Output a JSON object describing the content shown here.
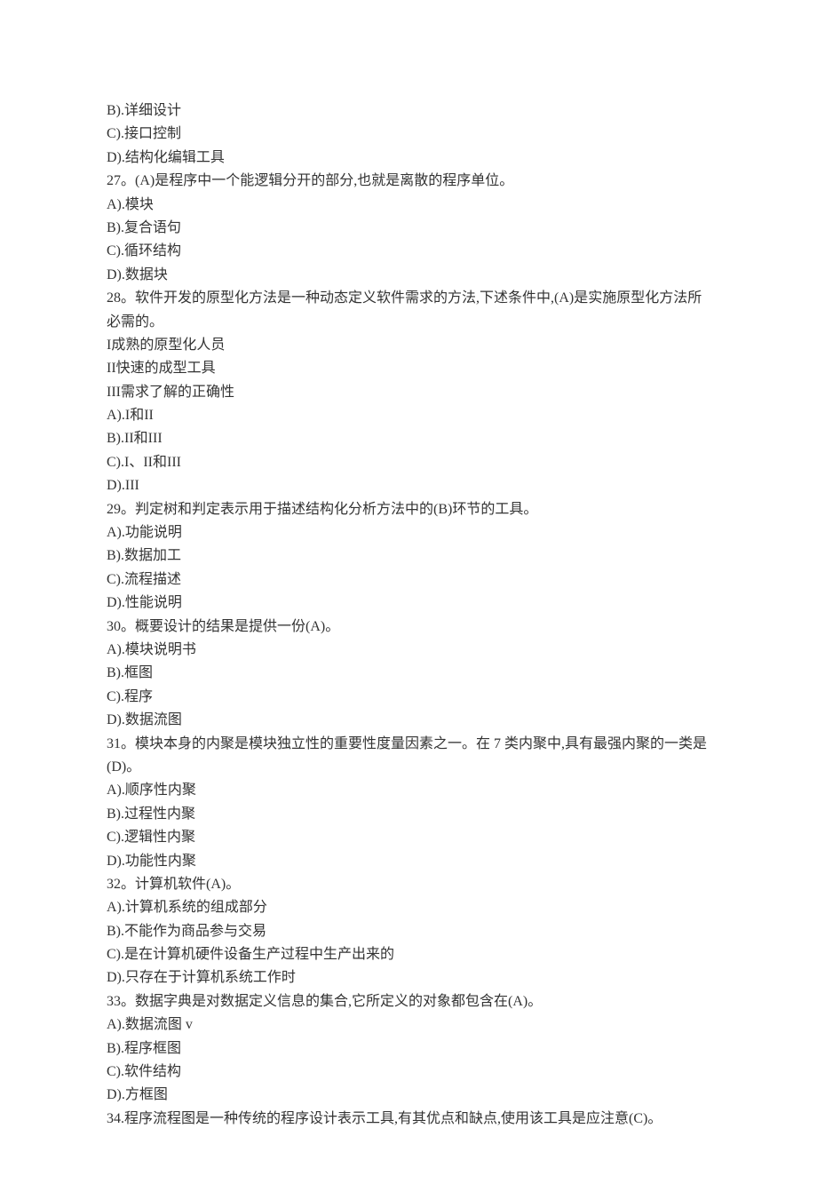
{
  "lines": [
    "B).详细设计",
    "C).接口控制",
    "D).结构化编辑工具",
    "27。(A)是程序中一个能逻辑分开的部分,也就是离散的程序单位。",
    "A).模块",
    "B).复合语句",
    "C).循环结构",
    "D).数据块",
    "28。软件开发的原型化方法是一种动态定义软件需求的方法,下述条件中,(A)是实施原型化方法所必需的。",
    "I成熟的原型化人员",
    "II快速的成型工具",
    "III需求了解的正确性",
    "A).I和II",
    "B).II和III",
    "C).I、II和III",
    "D).III",
    "29。判定树和判定表示用于描述结构化分析方法中的(B)环节的工具。",
    "A).功能说明",
    "B).数据加工",
    "C).流程描述",
    "D).性能说明",
    "30。概要设计的结果是提供一份(A)。",
    "A).模块说明书",
    "B).框图",
    "C).程序",
    "D).数据流图",
    "31。模块本身的内聚是模块独立性的重要性度量因素之一。在 7 类内聚中,具有最强内聚的一类是(D)。",
    "A).顺序性内聚",
    "B).过程性内聚",
    "C).逻辑性内聚",
    "D).功能性内聚",
    "32。计算机软件(A)。",
    "A).计算机系统的组成部分",
    "B).不能作为商品参与交易",
    "C).是在计算机硬件设备生产过程中生产出来的",
    "D).只存在于计算机系统工作时",
    "33。数据字典是对数据定义信息的集合,它所定义的对象都包含在(A)。",
    "A).数据流图 v",
    "B).程序框图",
    "C).软件结构",
    "D).方框图",
    "34.程序流程图是一种传统的程序设计表示工具,有其优点和缺点,使用该工具是应注意(C)。"
  ]
}
